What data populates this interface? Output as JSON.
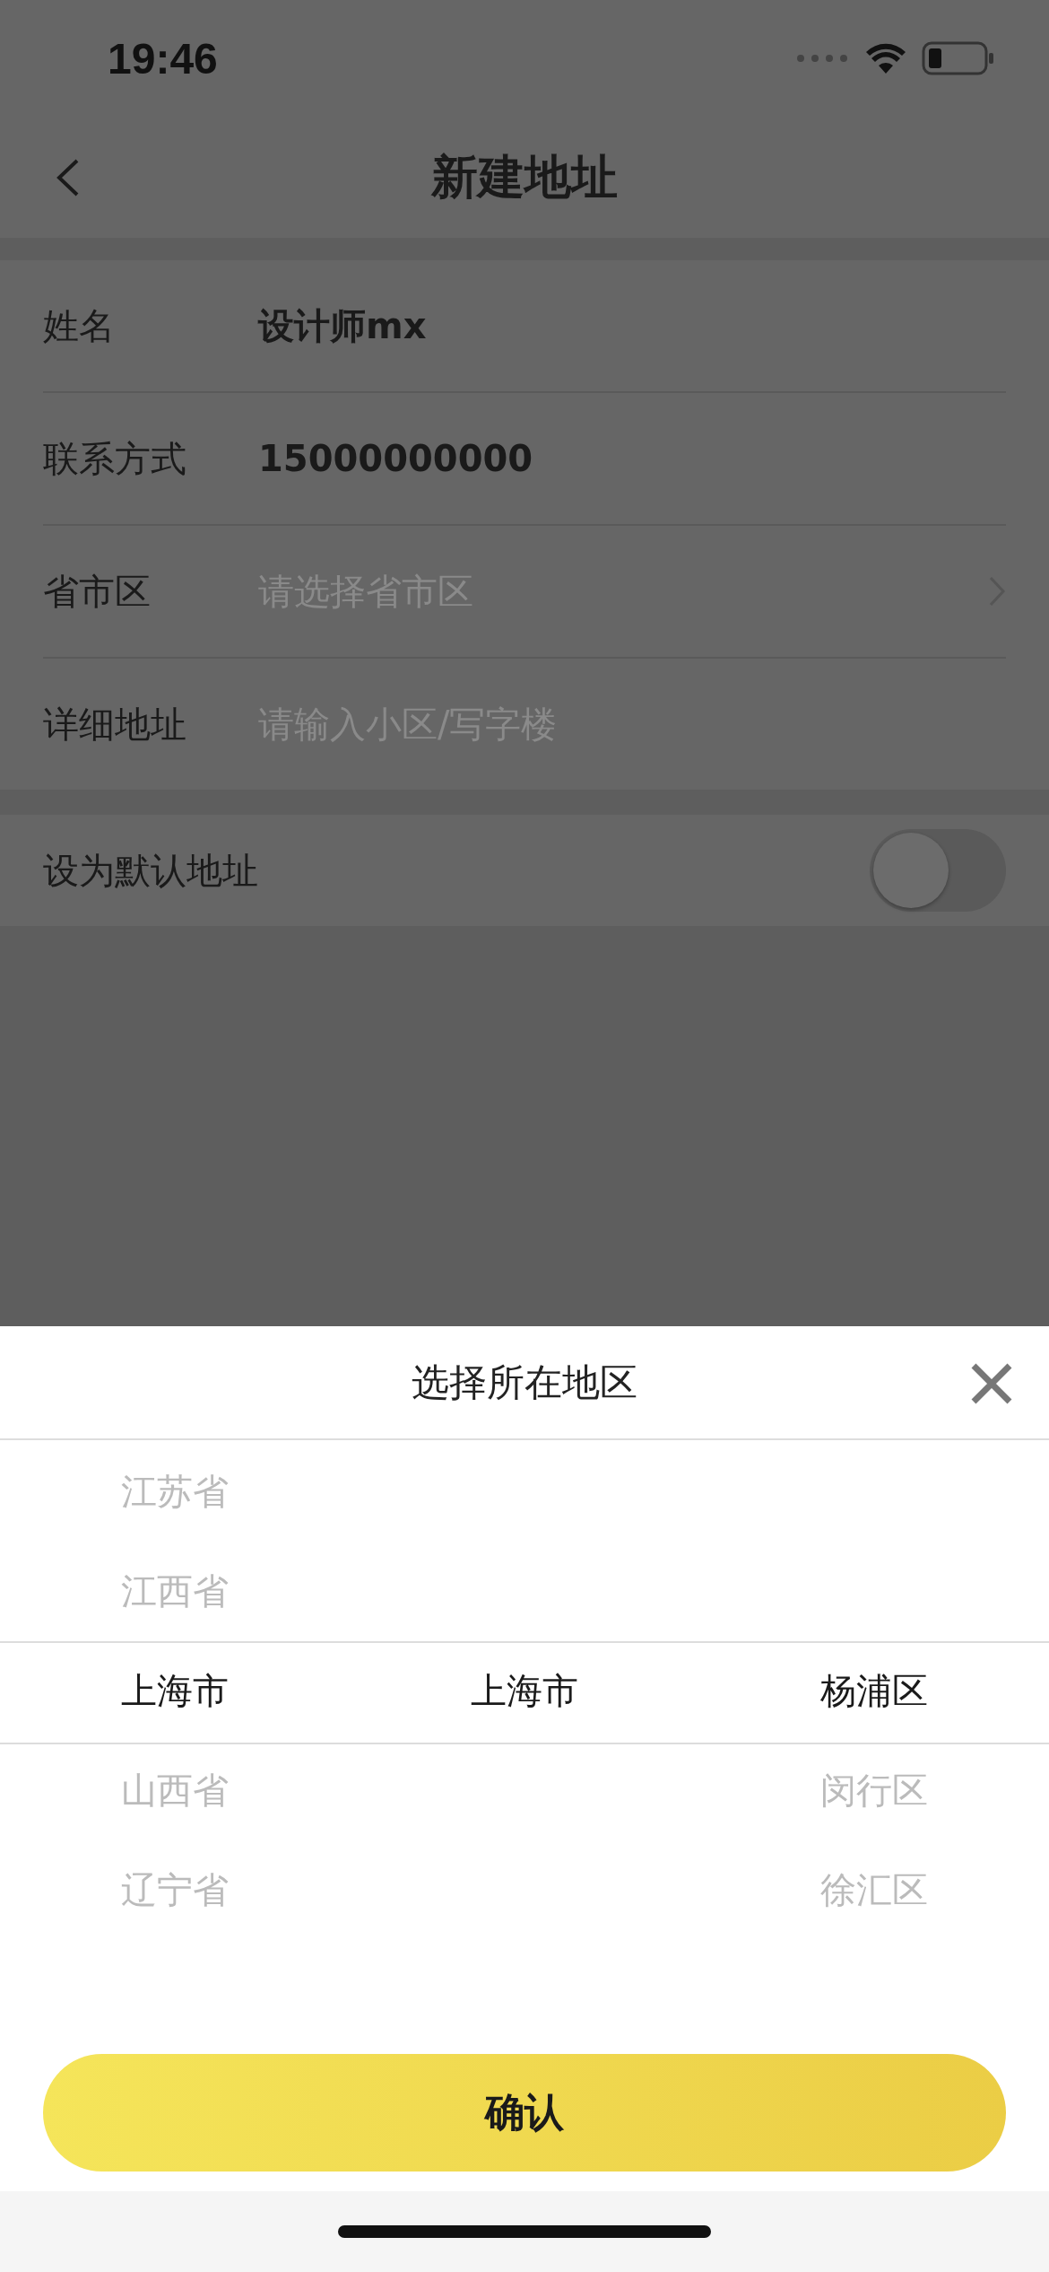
{
  "status_bar": {
    "time": "19:46"
  },
  "nav": {
    "title": "新建地址"
  },
  "form": {
    "rows": [
      {
        "kind": "value",
        "label": "姓名",
        "value": "设计师mx"
      },
      {
        "kind": "value",
        "label": "联系方式",
        "value": "15000000000"
      },
      {
        "kind": "select",
        "label": "省市区",
        "placeholder": "请选择省市区"
      },
      {
        "kind": "input",
        "label": "详细地址",
        "placeholder": "请输入小区/写字楼"
      }
    ]
  },
  "default_switch": {
    "label": "设为默认地址",
    "on": false
  },
  "sheet": {
    "title": "选择所在地区",
    "columns": [
      {
        "items": [
          {
            "text": "江苏省",
            "selected": false
          },
          {
            "text": "江西省",
            "selected": false
          },
          {
            "text": "上海市",
            "selected": true
          },
          {
            "text": "山西省",
            "selected": false
          },
          {
            "text": "辽宁省",
            "selected": false
          }
        ]
      },
      {
        "items": [
          {
            "text": "上海市",
            "selected": true
          }
        ]
      },
      {
        "items": [
          {
            "text": "杨浦区",
            "selected": true
          },
          {
            "text": "闵行区",
            "selected": false
          },
          {
            "text": "徐汇区",
            "selected": false
          }
        ]
      }
    ],
    "confirm": "确认"
  }
}
